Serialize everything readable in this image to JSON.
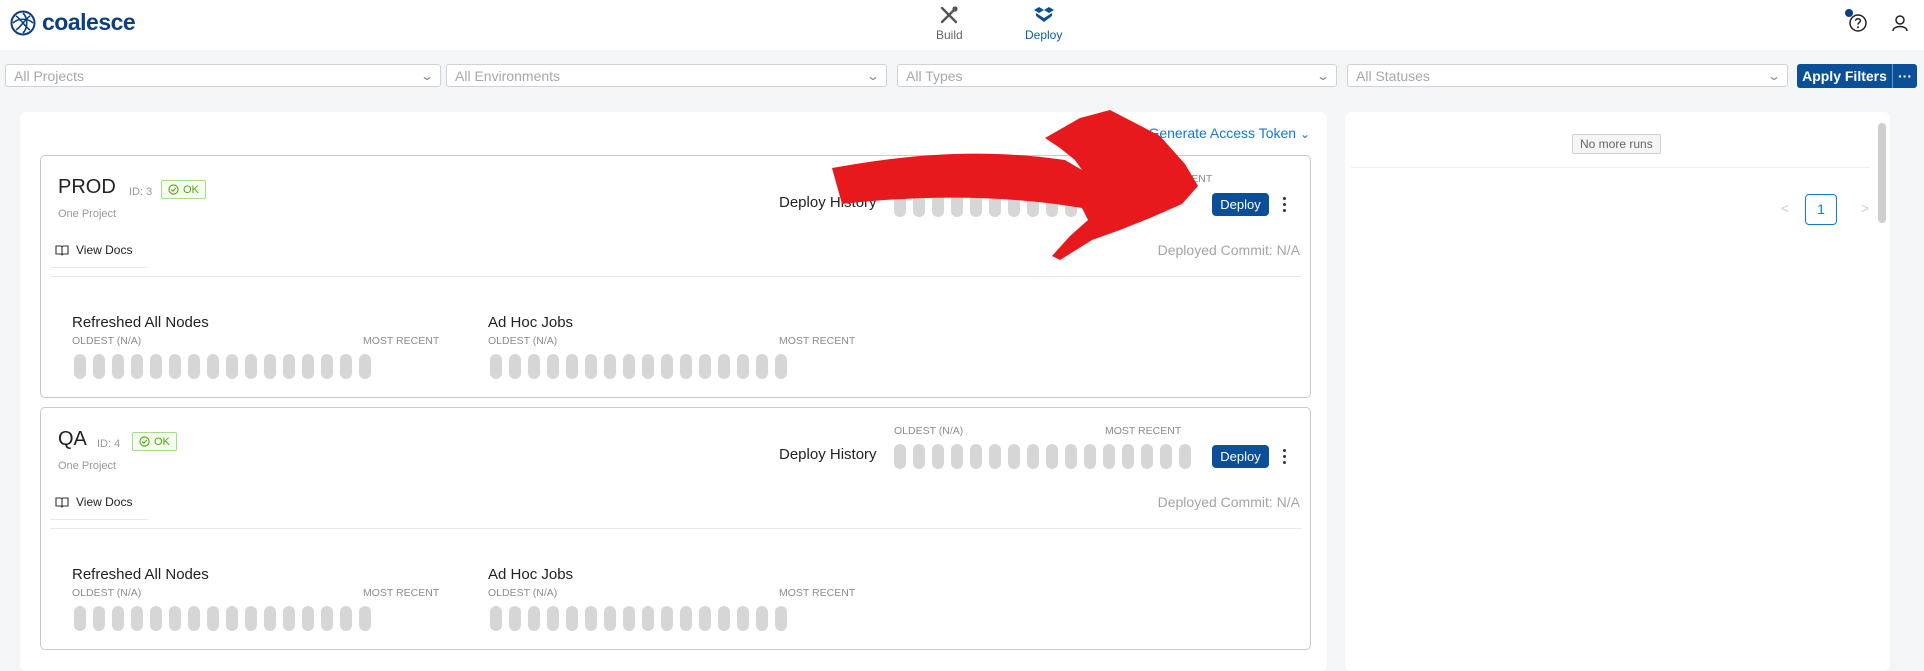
{
  "app": {
    "name": "coalesce",
    "brand_color": "#0c3f82"
  },
  "nav": [
    {
      "label": "Build",
      "icon": "wrench-screwdriver-icon",
      "active": false
    },
    {
      "label": "Deploy",
      "icon": "deploy-boxes-icon",
      "active": true
    }
  ],
  "filters": {
    "projects": "All Projects",
    "environments": "All Environments",
    "types": "All Types",
    "statuses": "All Statuses",
    "apply_label": "Apply Filters",
    "more_label": "···"
  },
  "main": {
    "generate_token": "Generate Access Token",
    "environments": [
      {
        "name": "PROD",
        "id": "ID: 3",
        "status": "OK",
        "project": "One Project",
        "view_docs": "View Docs",
        "deploy_history_label": "Deploy History",
        "history_oldest": "OLDEST (N/A)",
        "history_most_recent": "MOST RECENT",
        "deploy_label": "Deploy",
        "deployed_commit": "Deployed Commit: N/A",
        "jobs": [
          {
            "title": "Refreshed All Nodes",
            "oldest": "OLDEST (N/A)",
            "recent": "MOST RECENT"
          },
          {
            "title": "Ad Hoc Jobs",
            "oldest": "OLDEST (N/A)",
            "recent": "MOST RECENT"
          }
        ]
      },
      {
        "name": "QA",
        "id": "ID: 4",
        "status": "OK",
        "project": "One Project",
        "view_docs": "View Docs",
        "deploy_history_label": "Deploy History",
        "history_oldest": "OLDEST (N/A)",
        "history_most_recent": "MOST RECENT",
        "deploy_label": "Deploy",
        "deployed_commit": "Deployed Commit: N/A",
        "jobs": [
          {
            "title": "Refreshed All Nodes",
            "oldest": "OLDEST (N/A)",
            "recent": "MOST RECENT"
          },
          {
            "title": "Ad Hoc Jobs",
            "oldest": "OLDEST (N/A)",
            "recent": "MOST RECENT"
          }
        ]
      }
    ]
  },
  "runs": {
    "no_more_runs": "No more runs",
    "current_page": "1"
  },
  "colors": {
    "primary": "#0c4f99",
    "link": "#1577d4",
    "ok_green": "#52a41a",
    "annotation_arrow": "#e8191c"
  }
}
